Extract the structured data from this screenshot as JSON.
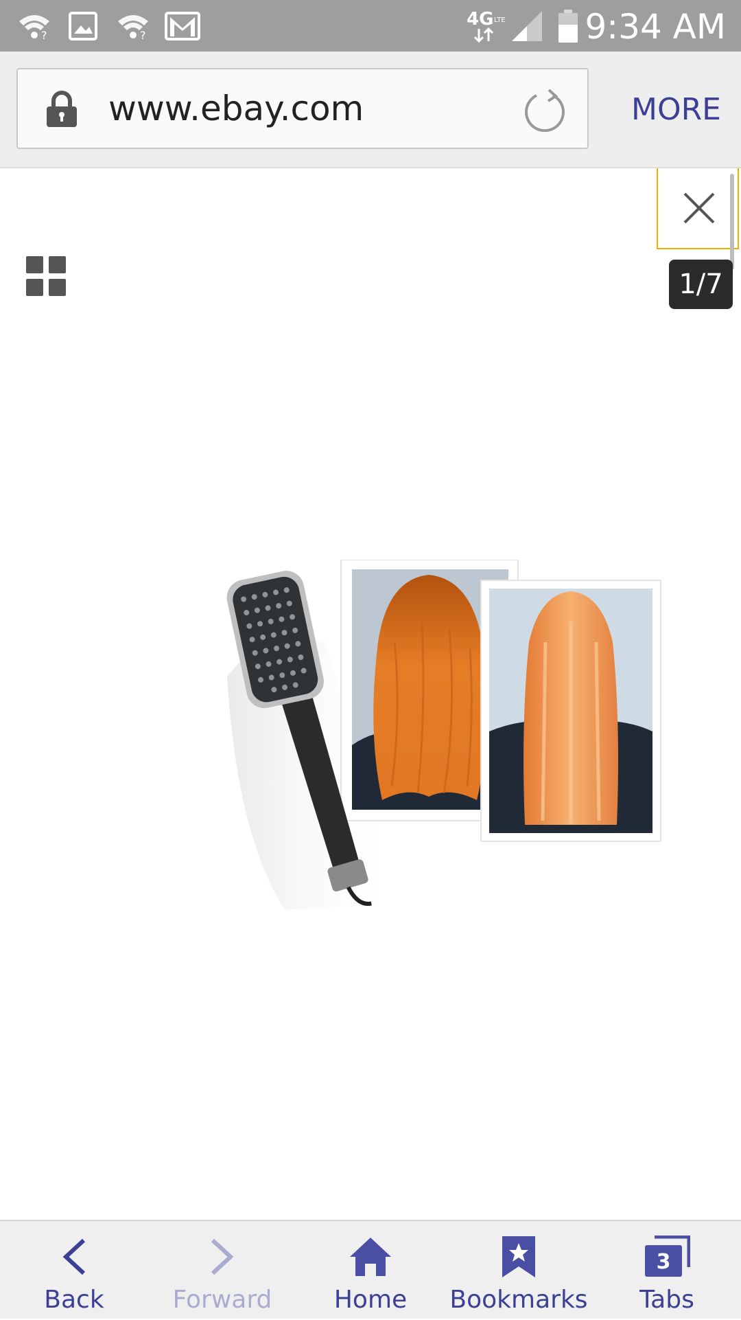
{
  "status_bar": {
    "time": "9:34 AM",
    "network": "4G LTE",
    "icons": [
      "wifi-question-icon",
      "image-icon",
      "wifi-question-icon",
      "gmail-icon",
      "network-4g-icon",
      "signal-icon",
      "battery-icon"
    ]
  },
  "browser": {
    "url": "www.ebay.com",
    "more_label": "MORE",
    "accent_color": "#3b3f95"
  },
  "gallery": {
    "counter": "1/7",
    "image_description_icon": "hair-dryer-brush-product-photo"
  },
  "bottom_nav": {
    "items": [
      {
        "label": "Back",
        "icon": "chevron-left-icon",
        "enabled": true
      },
      {
        "label": "Forward",
        "icon": "chevron-right-icon",
        "enabled": false
      },
      {
        "label": "Home",
        "icon": "home-icon",
        "enabled": true
      },
      {
        "label": "Bookmarks",
        "icon": "bookmark-star-icon",
        "enabled": true
      },
      {
        "label": "Tabs",
        "icon": "tabs-icon",
        "enabled": true,
        "count": "3"
      }
    ]
  }
}
